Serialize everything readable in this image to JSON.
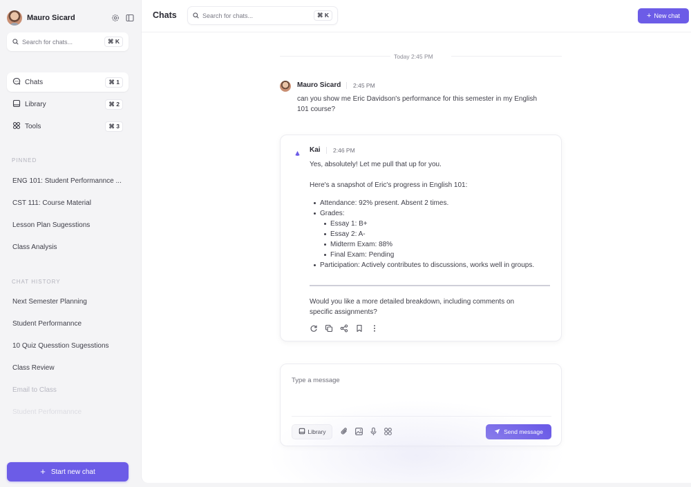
{
  "sidebar": {
    "profile_name": "Mauro Sicard",
    "search_placeholder": "Search for chats...",
    "search_shortcut": "⌘ K",
    "nav": [
      {
        "label": "Chats",
        "shortcut": "⌘ 1",
        "icon": "chat-bubble-icon"
      },
      {
        "label": "Library",
        "shortcut": "⌘ 2",
        "icon": "library-icon"
      },
      {
        "label": "Tools",
        "shortcut": "⌘ 3",
        "icon": "tools-grid-icon"
      }
    ],
    "pinned_title": "PINNED",
    "pinned": [
      "ENG 101: Student Performannce ...",
      "CST 111: Course Material",
      "Lesson Plan Sugesstions",
      "Class Analysis"
    ],
    "history_title": "CHAT HISTORY",
    "history": [
      "Next Semester Planning",
      "Student Performannce",
      "10 Quiz Quesstion Sugesstions",
      "Class Review",
      "Email to Class",
      "Student Performannce"
    ],
    "start_new_chat": "Start new chat"
  },
  "header": {
    "title": "Chats",
    "search_placeholder": "Search for chats...",
    "search_shortcut": "⌘ K",
    "new_chat": "New chat"
  },
  "conversation": {
    "date_label": "Today 2:45 PM",
    "user": {
      "name": "Mauro Sicard",
      "time": "2:45 PM",
      "message_line1": "can you show me Eric Davidson's performance for this semester in my English",
      "message_line2": "101 course?"
    },
    "assistant": {
      "name": "Kai",
      "time": "2:46 PM",
      "greeting": "Yes, absolutely! Let me pull that up for you.",
      "intro": "Here's a snapshot of Eric's progress in English 101:",
      "attendance": "Attendance: 92% present. Absent 2 times.",
      "grades_label": "Grades:",
      "grades": [
        "Essay 1: B+",
        "Essay 2: A-",
        "Midterm Exam: 88%",
        "Final Exam: Pending"
      ],
      "participation": "Participation: Actively contributes to discussions, works well in groups.",
      "followup_line1": "Would you like a more detailed breakdown, including comments on",
      "followup_line2": "specific assignments?"
    }
  },
  "composer": {
    "placeholder": "Type a message",
    "library_label": "Library",
    "send_label": "Send message"
  },
  "colors": {
    "accent": "#6c5ce7",
    "background": "#f4f4f6",
    "panel": "#ffffff"
  }
}
